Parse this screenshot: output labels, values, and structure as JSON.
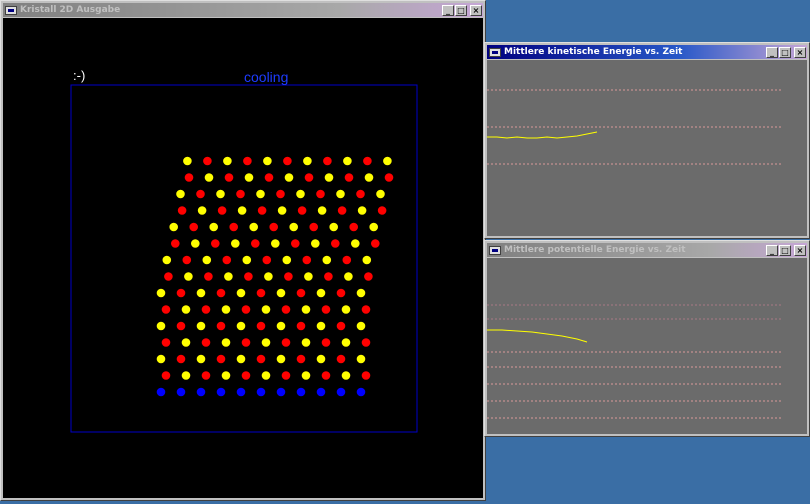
{
  "colors": {
    "desktop": "#3a6ea5",
    "canvas_bg": "#000000",
    "frame": "#0000c8",
    "label_blue": "#1e3cff",
    "atom_yellow": "#ffff00",
    "atom_red": "#ff0000",
    "atom_blue": "#0000ff",
    "plot_bg": "#6b6b6b",
    "grid_pink": "#d89a9a",
    "curve": "#ffff00"
  },
  "controls": {
    "minimize": "_",
    "maximize": "□",
    "close": "×"
  },
  "window_main": {
    "title": "Kristall 2D Ausgabe",
    "smiley": ":-)",
    "status": "cooling"
  },
  "window_kinetic": {
    "title": "Mittlere kinetische Energie vs. Zeit"
  },
  "window_potential": {
    "title": "Mittlere potentielle Energie vs. Zeit"
  },
  "crystal": {
    "pattern": "hexagonal lattice, yellow / red atoms with a bottom row of blue fixed atoms",
    "rows": 15,
    "atoms_per_row": 11,
    "shear": "lattice leans right, top row offset furthest"
  }
}
